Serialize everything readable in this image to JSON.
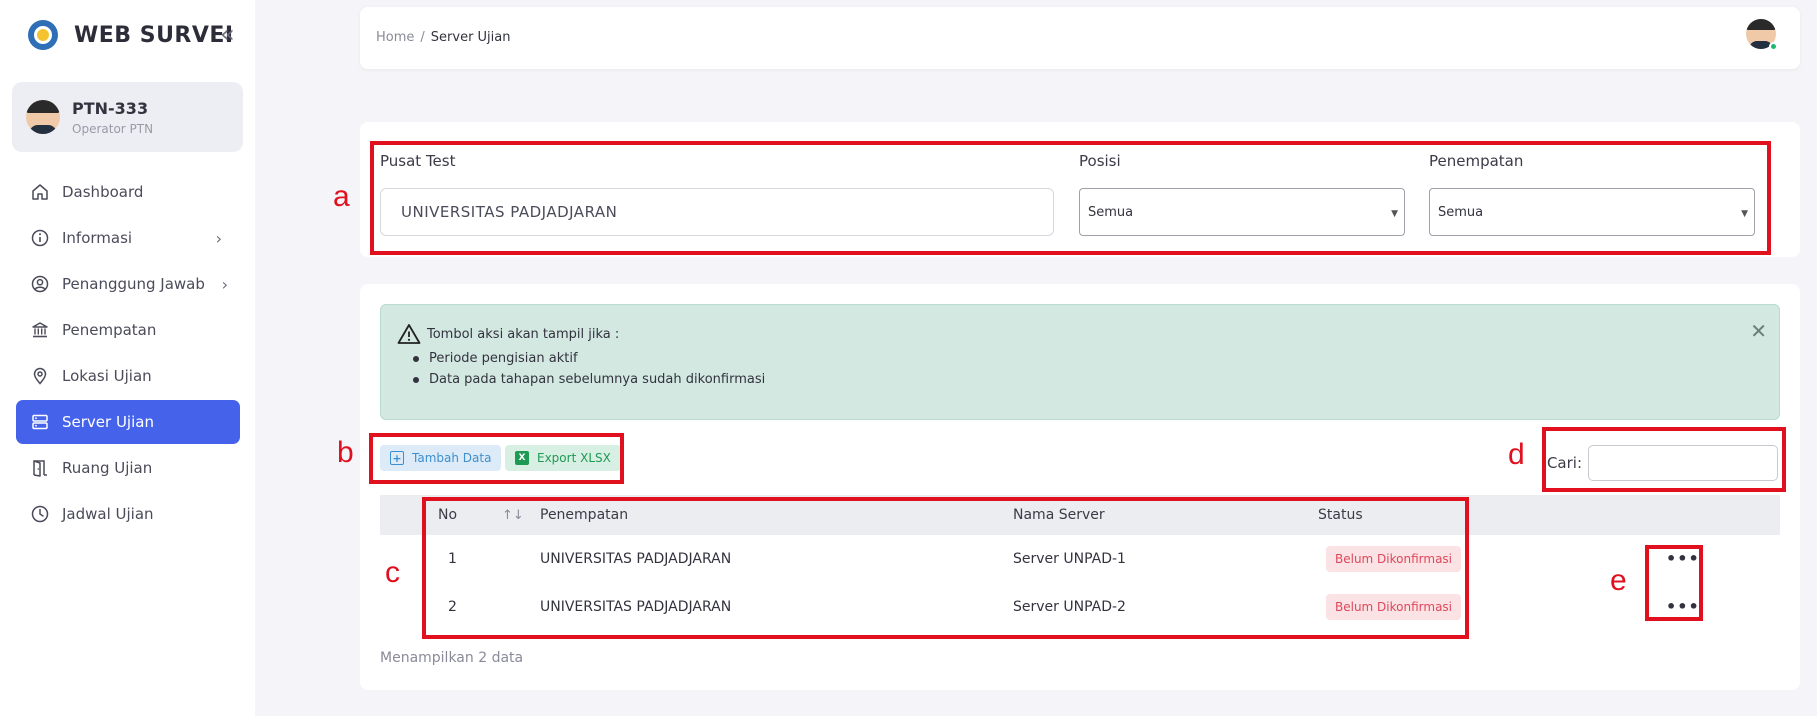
{
  "sidebar": {
    "brand": "WEB SURVEI",
    "collapse_icon": "double-chevron-left-icon",
    "user": {
      "name": "PTN-333",
      "role": "Operator PTN"
    },
    "items": [
      {
        "label": "Dashboard",
        "icon": "home-icon"
      },
      {
        "label": "Informasi",
        "icon": "info-icon",
        "has_submenu": true
      },
      {
        "label": "Penanggung Jawab",
        "icon": "user-circle-icon",
        "has_submenu": true
      },
      {
        "label": "Penempatan",
        "icon": "bank-icon"
      },
      {
        "label": "Lokasi Ujian",
        "icon": "map-pin-icon"
      },
      {
        "label": "Server Ujian",
        "icon": "server-icon",
        "active": true
      },
      {
        "label": "Ruang Ujian",
        "icon": "door-icon"
      },
      {
        "label": "Jadwal Ujian",
        "icon": "clock-icon"
      }
    ],
    "arrow": "›"
  },
  "header": {
    "breadcrumb": {
      "home": "Home",
      "separator": "/",
      "current": "Server Ujian"
    }
  },
  "filters": {
    "pusat_test": {
      "label": "Pusat Test",
      "value": "UNIVERSITAS PADJADJARAN"
    },
    "posisi": {
      "label": "Posisi",
      "value": "Semua"
    },
    "penempatan": {
      "label": "Penempatan",
      "value": "Semua"
    },
    "caret": "▼"
  },
  "alert": {
    "title": "Tombol aksi akan tampil jika :",
    "items": [
      "Periode pengisian aktif",
      "Data pada tahapan sebelumnya sudah dikonfirmasi"
    ],
    "close": "✕"
  },
  "toolbar": {
    "add_label": "Tambah Data",
    "add_icon": "+",
    "export_label": "Export XLSX",
    "export_icon": "X",
    "search_label": "Cari:",
    "search_value": ""
  },
  "table": {
    "headers": {
      "no": "No",
      "sort": "↑↓",
      "penempatan": "Penempatan",
      "nama_server": "Nama Server",
      "status": "Status"
    },
    "rows": [
      {
        "no": "1",
        "penempatan": "UNIVERSITAS PADJADJARAN",
        "nama_server": "Server UNPAD-1",
        "status": "Belum Dikonfirmasi",
        "action": "•••"
      },
      {
        "no": "2",
        "penempatan": "UNIVERSITAS PADJADJARAN",
        "nama_server": "Server UNPAD-2",
        "status": "Belum Dikonfirmasi",
        "action": "•••"
      }
    ],
    "footer": "Menampilkan 2 data"
  },
  "annotations": {
    "a": "a",
    "b": "b",
    "c": "c",
    "d": "d",
    "e": "e"
  },
  "colors": {
    "accent": "#4563ea",
    "annotation_red": "#e0101f",
    "alert_bg": "#d2e8e0",
    "badge_text": "#e0475a"
  }
}
